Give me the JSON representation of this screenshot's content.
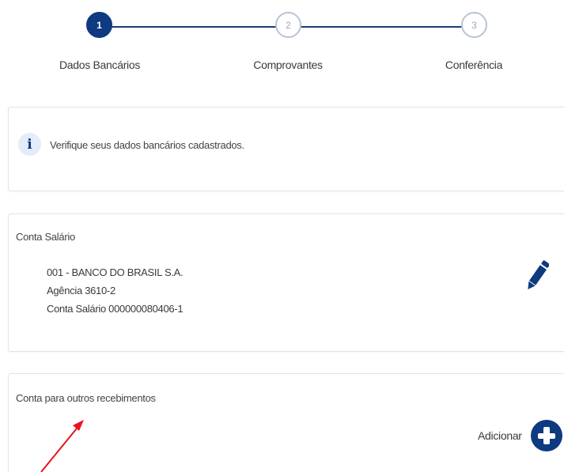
{
  "stepper": {
    "steps": [
      {
        "number": "1",
        "label": "Dados Bancários",
        "state": "active"
      },
      {
        "number": "2",
        "label": "Comprovantes",
        "state": "inactive"
      },
      {
        "number": "3",
        "label": "Conferência",
        "state": "inactive"
      }
    ]
  },
  "info": {
    "icon": "info-icon",
    "icon_glyph": "i",
    "message": "Verifique seus dados bancários cadastrados."
  },
  "salary_account": {
    "title": "Conta Salário",
    "bank": "001 - BANCO DO BRASIL S.A.",
    "agency": "Agência 3610-2",
    "account": "Conta Salário 000000080406-1",
    "edit_icon": "pencil-icon"
  },
  "other_account": {
    "title": "Conta para outros recebimentos",
    "add_label": "Adicionar",
    "add_icon": "plus-icon"
  },
  "colors": {
    "primary": "#0e3a80",
    "annotation_arrow": "#e8141b"
  }
}
